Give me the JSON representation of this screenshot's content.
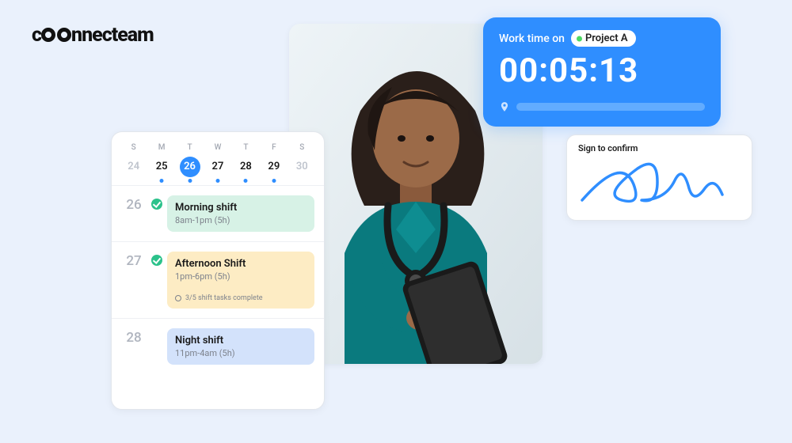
{
  "brand": {
    "name": "connecteam",
    "rest": "nnecteam"
  },
  "timer": {
    "label": "Work time on",
    "project": "Project A",
    "elapsed": "00:05:13"
  },
  "signature": {
    "label": "Sign to confirm"
  },
  "schedule": {
    "daysOfWeek": [
      "S",
      "M",
      "T",
      "W",
      "T",
      "F",
      "S"
    ],
    "dates": [
      24,
      25,
      26,
      27,
      28,
      29,
      30
    ],
    "selectedIndex": 2,
    "dotIndices": [
      1,
      2,
      3,
      4,
      5
    ],
    "dimIndices": [
      0,
      6
    ],
    "shifts": [
      {
        "date": 26,
        "name": "Morning shift",
        "time": "8am-1pm (5h)",
        "color": "#d7f2e6",
        "checked": true
      },
      {
        "date": 27,
        "name": "Afternoon Shift",
        "time": "1pm-6pm (5h)",
        "color": "#fdecc4",
        "checked": true,
        "tasks": "3/5 shift tasks complete"
      },
      {
        "date": 28,
        "name": "Night shift",
        "time": "11pm-4am (5h)",
        "color": "#d3e2fb",
        "checked": false
      }
    ]
  }
}
